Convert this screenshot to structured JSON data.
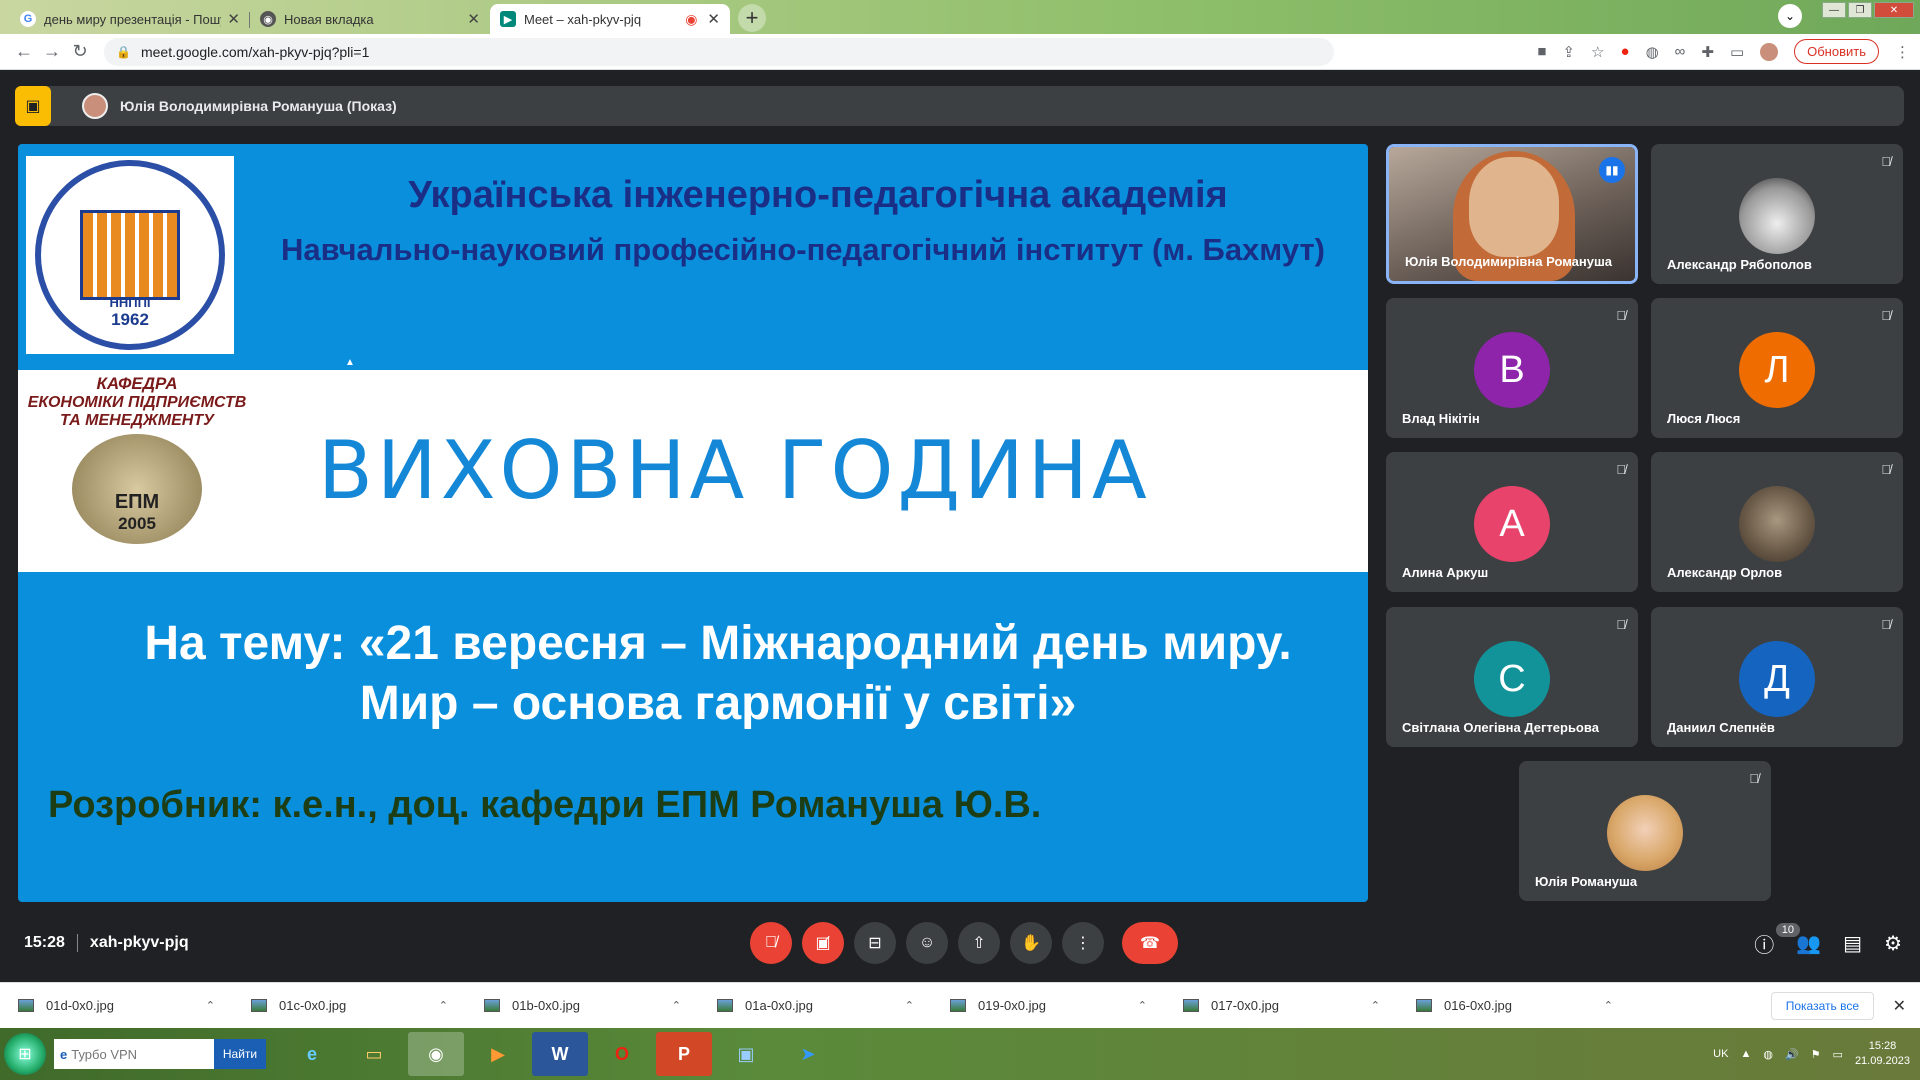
{
  "browser": {
    "tabs": [
      {
        "title": "день миру презентація - Пошук",
        "icon": "google-icon",
        "active": false
      },
      {
        "title": "Новая вкладка",
        "icon": "chrome-icon",
        "active": false
      },
      {
        "title": "Meet – xah-pkyv-pjq",
        "icon": "meet-icon",
        "active": true
      }
    ],
    "url": "meet.google.com/xah-pkyv-pjq?pli=1",
    "update_label": "Обновить"
  },
  "meet": {
    "presenter_label": "Юлія Володимирівна Романуша (Показ)",
    "time": "15:28",
    "meeting_code": "xah-pkyv-pjq",
    "participant_count": "10"
  },
  "slide": {
    "heading1": "Українська інженерно-педагогічна академія",
    "heading2": "Навчально-науковий професійно-педагогічний інститут (м. Бахмут)",
    "logo1_abbr": "ННППІ",
    "logo1_year": "1962",
    "logo2_line1": "КАФЕДРА",
    "logo2_line2": "ЕКОНОМІКИ ПІДПРИЄМСТВ",
    "logo2_line3": "ТА МЕНЕДЖМЕНТУ",
    "logo2_abbr": "ЕПМ",
    "logo2_year": "2005",
    "title": "ВИХОВНА ГОДИНА",
    "topic_line1": "На тему: «21 вересня – Міжнародний день миру.",
    "topic_line2": "Мир – основа гармонії у світі»",
    "author": "Розробник: к.е.н., доц. кафедри ЕПМ Романуша Ю.В."
  },
  "participants": [
    {
      "name": "Юлія Володимирівна Романуша",
      "type": "video"
    },
    {
      "name": "Александр Рябополов",
      "type": "photo"
    },
    {
      "name": "Влад Нікітін",
      "letter": "В",
      "color": "#8e24aa"
    },
    {
      "name": "Люся Люся",
      "letter": "Л",
      "color": "#ef6c00"
    },
    {
      "name": "Алина Аркуш",
      "letter": "А",
      "color": "#e8446b"
    },
    {
      "name": "Александр Орлов",
      "type": "photo"
    },
    {
      "name": "Світлана Олегівна Дегтерьова",
      "letter": "С",
      "color": "#12939a"
    },
    {
      "name": "Даниил Слепнёв",
      "letter": "Д",
      "color": "#1565c0"
    },
    {
      "name": "Юлія Романуша",
      "type": "photo"
    }
  ],
  "downloads": {
    "files": [
      "01d-0x0.jpg",
      "01c-0x0.jpg",
      "01b-0x0.jpg",
      "01a-0x0.jpg",
      "019-0x0.jpg",
      "017-0x0.jpg",
      "016-0x0.jpg"
    ],
    "show_all": "Показать все"
  },
  "taskbar": {
    "search_placeholder": "Турбо VPN",
    "search_button": "Найти",
    "lang": "UK",
    "time": "15:28",
    "date": "21.09.2023"
  }
}
